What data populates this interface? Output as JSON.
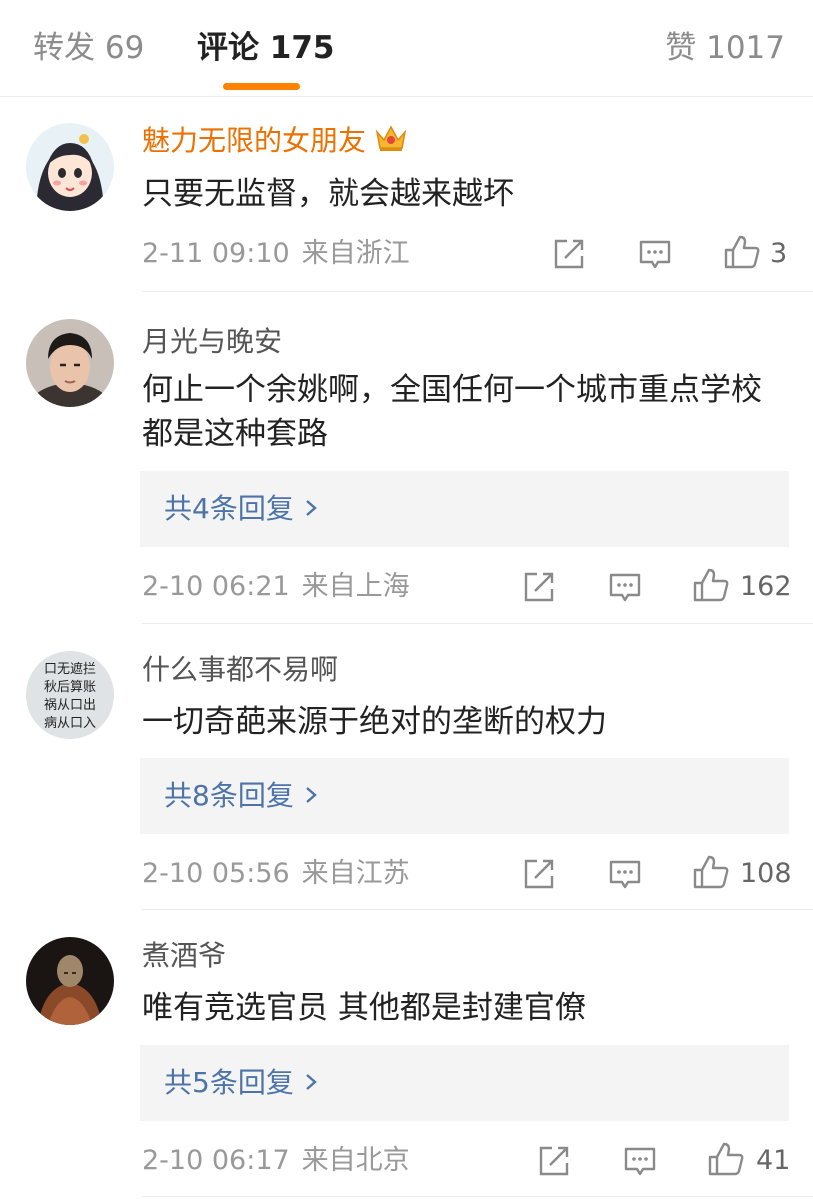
{
  "tabs": {
    "repost": "转发 69",
    "comment": "评论 175",
    "like": "赞 1017"
  },
  "colors": {
    "accent": "#ff8200",
    "vip_name": "#eb7100",
    "reply_link": "#4d74a8"
  },
  "comments": [
    {
      "username": "魅力无限的女朋友",
      "vip_badge": "crown-icon",
      "text": "只要无监督，就会越来越坏",
      "time": "2-11 09:10",
      "location": "来自浙江",
      "likes": "3"
    },
    {
      "username": "月光与晚安",
      "text": "何止一个余姚啊，全国任何一个城市重点学校都是这种套路",
      "replies": "共4条回复",
      "time": "2-10 06:21",
      "location": "来自上海",
      "likes": "162"
    },
    {
      "username": "什么事都不易啊",
      "avatar_text": [
        "口无遮拦",
        "秋后算账",
        "祸从口出",
        "病从口入"
      ],
      "text": "一切奇葩来源于绝对的垄断的权力",
      "replies": "共8条回复",
      "time": "2-10 05:56",
      "location": "来自江苏",
      "likes": "108"
    },
    {
      "username": "煮酒爷",
      "text": "唯有竞选官员 其他都是封建官僚",
      "replies": "共5条回复",
      "time": "2-10 06:17",
      "location": "来自北京",
      "likes": "41"
    }
  ]
}
